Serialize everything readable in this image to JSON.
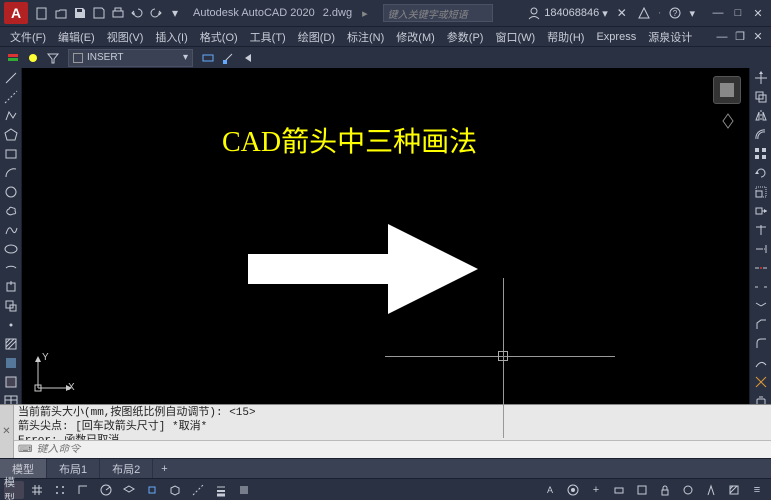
{
  "app": {
    "title": "Autodesk AutoCAD 2020",
    "filename": "2.dwg",
    "search_placeholder": "键入关键字或短语",
    "user": "184068846"
  },
  "menu": [
    "文件(F)",
    "编辑(E)",
    "视图(V)",
    "插入(I)",
    "格式(O)",
    "工具(T)",
    "绘图(D)",
    "标注(N)",
    "修改(M)",
    "参数(P)",
    "窗口(W)",
    "帮助(H)",
    "Express",
    "源泉设计"
  ],
  "toolbar": {
    "layer": "INSERT"
  },
  "canvas": {
    "headline": "CAD箭头中三种画法",
    "ucs_x": "X",
    "ucs_y": "Y"
  },
  "command": {
    "history": "当前箭头大小(mm,按图纸比例自动调节): <15>\n箭头尖点: [回车改箭头尺寸] *取消*\nError: 函数已取消\n命令:",
    "input_placeholder": "键入命令"
  },
  "tabs": {
    "items": [
      "模型",
      "布局1",
      "布局2"
    ],
    "active": 0
  }
}
